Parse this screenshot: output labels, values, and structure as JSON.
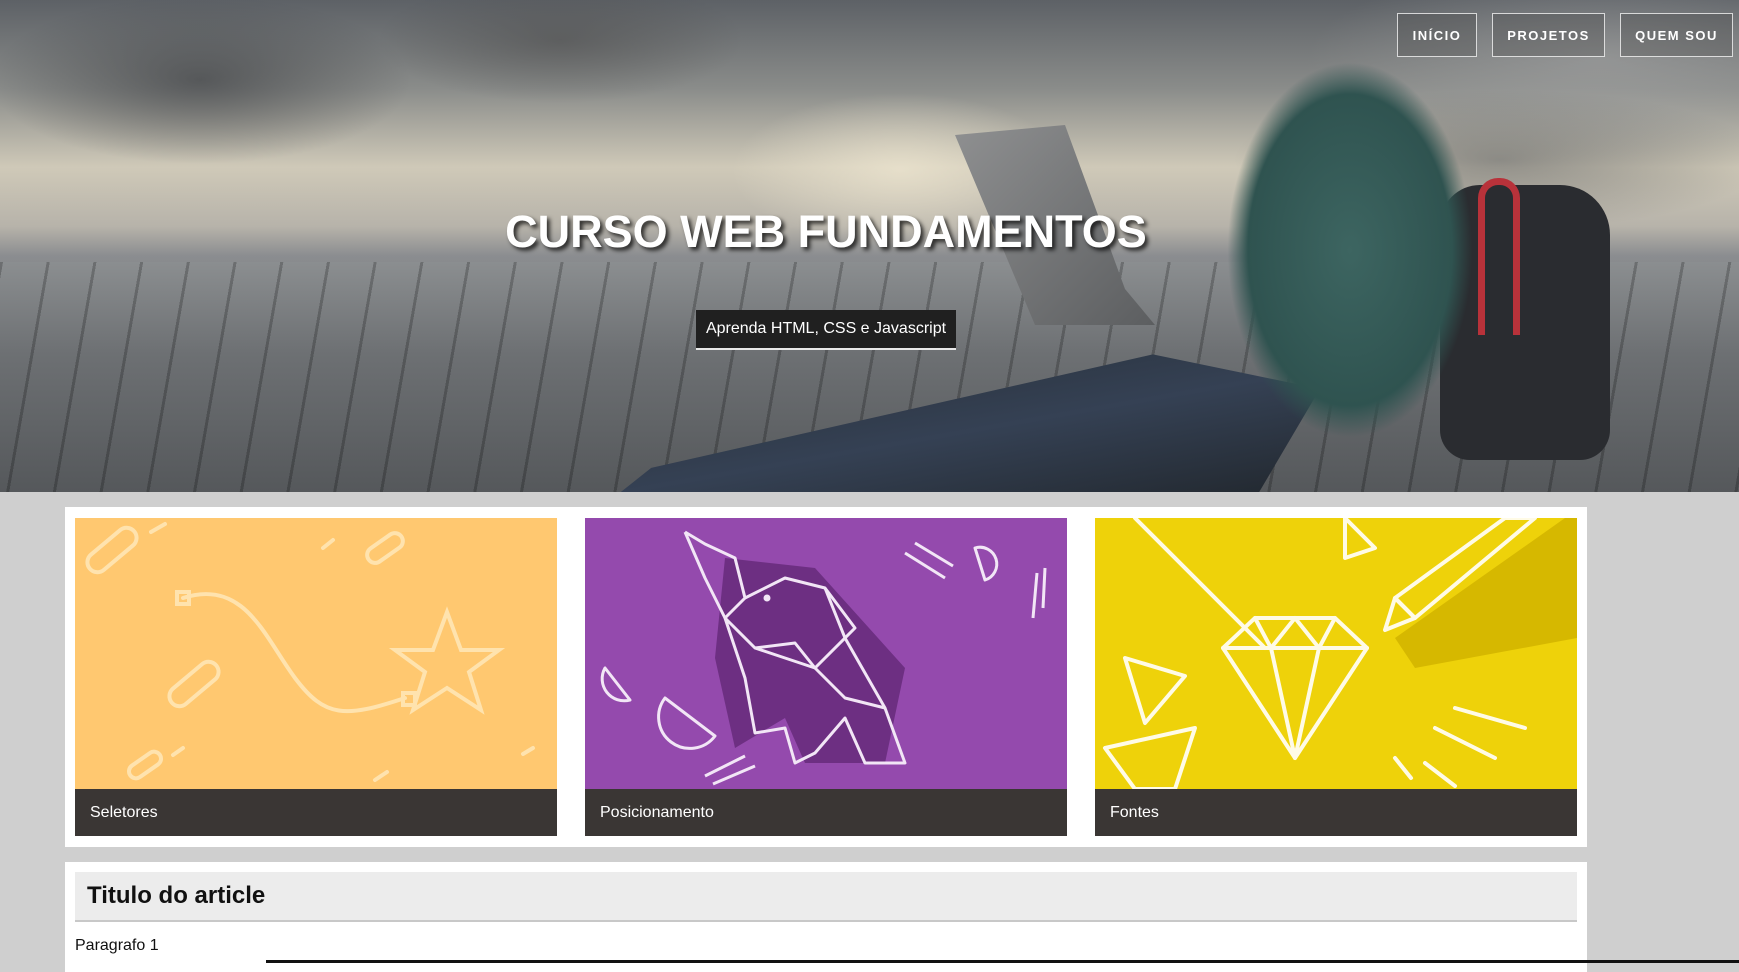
{
  "nav": {
    "items": [
      {
        "label": "INÍCIO"
      },
      {
        "label": "PROJETOS"
      },
      {
        "label": "QUEM SOU"
      }
    ]
  },
  "hero": {
    "title": "CURSO WEB FUNDAMENTOS",
    "subtitle": "Aprenda HTML, CSS e Javascript"
  },
  "cards": [
    {
      "caption": "Seletores",
      "color": "#ffc870",
      "icon": "star-wand-illustration"
    },
    {
      "caption": "Posicionamento",
      "color": "#944aad",
      "icon": "origami-elephant-illustration"
    },
    {
      "caption": "Fontes",
      "color": "#eed20a",
      "icon": "diamond-pencil-illustration"
    }
  ],
  "article": {
    "title": "Titulo do article",
    "paragraph": "Paragrafo 1"
  }
}
